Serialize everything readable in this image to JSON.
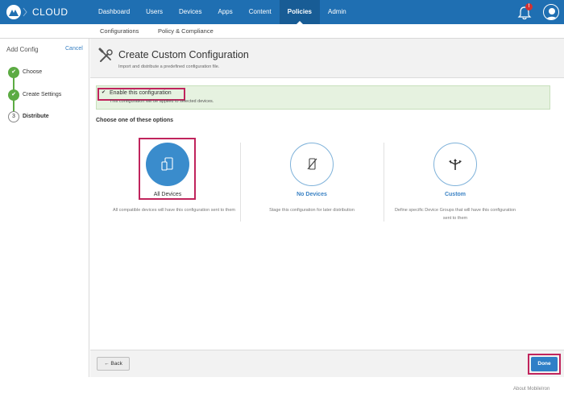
{
  "app": {
    "brand": "CLOUD"
  },
  "nav": {
    "items": [
      {
        "label": "Dashboard",
        "active": false
      },
      {
        "label": "Users",
        "active": false
      },
      {
        "label": "Devices",
        "active": false
      },
      {
        "label": "Apps",
        "active": false
      },
      {
        "label": "Content",
        "active": false
      },
      {
        "label": "Policies",
        "active": true
      },
      {
        "label": "Admin",
        "active": false
      }
    ],
    "notification_badge": "!"
  },
  "subnav": {
    "items": [
      {
        "label": "Configurations",
        "active": true
      },
      {
        "label": "Policy & Compliance",
        "active": false
      }
    ]
  },
  "wizard": {
    "title": "Add Config",
    "cancel_label": "Cancel",
    "steps": [
      {
        "marker": "✔",
        "label": "Choose",
        "state": "done"
      },
      {
        "marker": "✔",
        "label": "Create Settings",
        "state": "done"
      },
      {
        "marker": "3",
        "label": "Distribute",
        "state": "current"
      }
    ]
  },
  "header": {
    "title": "Create Custom Configuration",
    "subtitle": "Import and distribute a predefined configuration file."
  },
  "enable": {
    "checked": true,
    "label": "Enable this configuration",
    "description": "This configuration will be applied to selected devices."
  },
  "options": {
    "title": "Choose one of these options",
    "items": [
      {
        "label": "All Devices",
        "description": "All compatible devices will have this configuration sent to them",
        "selected": true,
        "icon": "devices-icon"
      },
      {
        "label": "No Devices",
        "description": "Stage this configuration for later distribution",
        "selected": false,
        "icon": "no-device-icon"
      },
      {
        "label": "Custom",
        "description": "Define specific Device Groups that will have this configuration sent to them",
        "selected": false,
        "icon": "custom-split-icon"
      }
    ]
  },
  "footer": {
    "back_label": "← Back",
    "done_label": "Done",
    "about_label": "About MobileIron"
  },
  "colors": {
    "primary": "#1f6fb2",
    "step_done": "#5cab43",
    "highlight": "#c0245c",
    "enable_bg": "#e6f2e0"
  }
}
